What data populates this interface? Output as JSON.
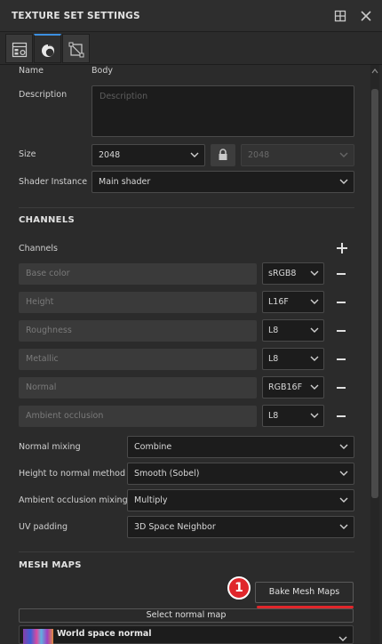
{
  "window": {
    "title": "TEXTURE SET SETTINGS"
  },
  "tabs": [
    {
      "icon": "texture-set-list-icon"
    },
    {
      "icon": "material-sphere-icon",
      "active": true
    },
    {
      "icon": "uv-frame-icon"
    }
  ],
  "general": {
    "name_label": "Name",
    "name_value": "Body",
    "description_label": "Description",
    "description_placeholder": "Description",
    "size_label": "Size",
    "size_value": "2048",
    "size_value_locked": "2048",
    "shader_label": "Shader Instance",
    "shader_value": "Main shader"
  },
  "channels": {
    "section_title": "CHANNELS",
    "label": "Channels",
    "items": [
      {
        "name": "Base color",
        "format": "sRGB8"
      },
      {
        "name": "Height",
        "format": "L16F"
      },
      {
        "name": "Roughness",
        "format": "L8"
      },
      {
        "name": "Metallic",
        "format": "L8"
      },
      {
        "name": "Normal",
        "format": "RGB16F"
      },
      {
        "name": "Ambient occlusion",
        "format": "L8"
      }
    ],
    "normal_mixing_label": "Normal mixing",
    "normal_mixing_value": "Combine",
    "height_to_normal_label": "Height to normal method",
    "height_to_normal_value": "Smooth (Sobel)",
    "ao_mixing_label": "Ambient occlusion mixing",
    "ao_mixing_value": "Multiply",
    "uv_padding_label": "UV padding",
    "uv_padding_value": "3D Space Neighbor"
  },
  "mesh_maps": {
    "section_title": "MESH MAPS",
    "bake_button": "Bake Mesh Maps",
    "annotation_number": "1",
    "select_normal_map": "Select normal map",
    "map_item_name": "World space normal"
  },
  "colors": {
    "accent_blue": "#3c8fe0",
    "annotation_red": "#e0262b"
  }
}
